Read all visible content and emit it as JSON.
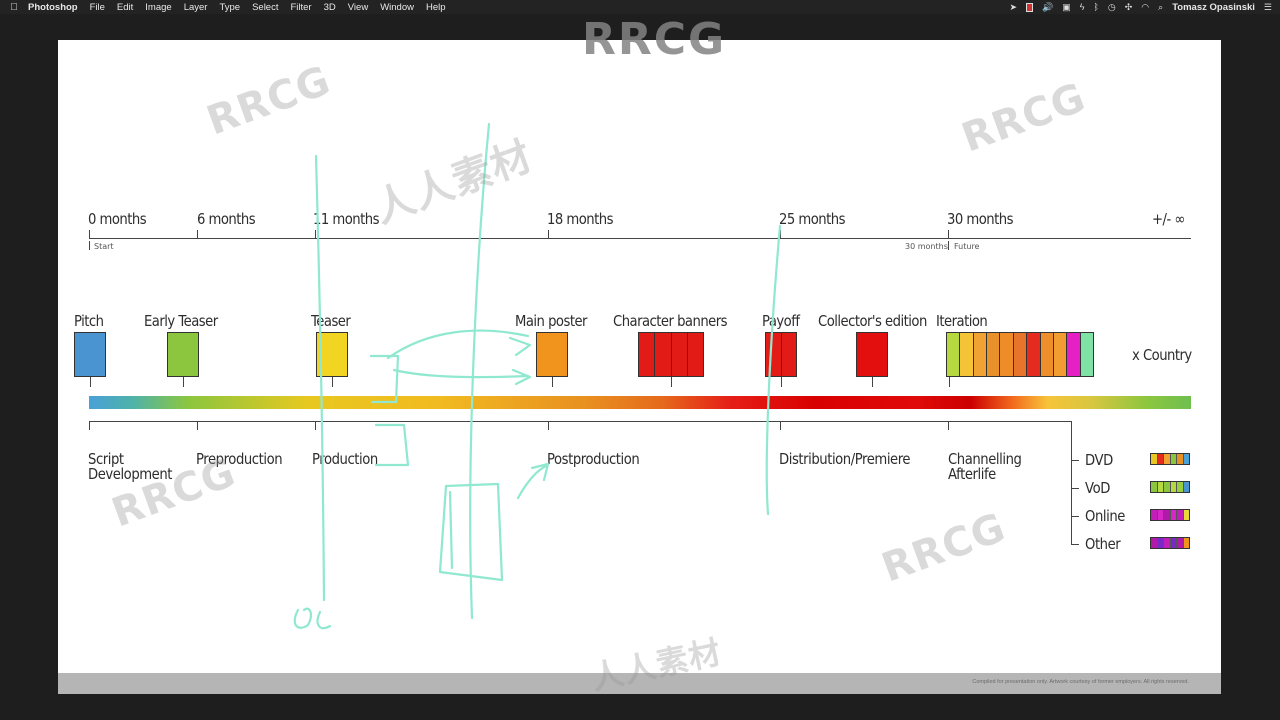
{
  "menubar": {
    "app_name": "Photoshop",
    "menus": [
      "File",
      "Edit",
      "Image",
      "Layer",
      "Type",
      "Select",
      "Filter",
      "3D",
      "View",
      "Window",
      "Help"
    ],
    "user": "Tomasz Opasinski",
    "status_icons": [
      "location-icon",
      "battery-icon",
      "volume-icon",
      "display-icon",
      "power-icon",
      "bluetooth-icon",
      "time-machine-icon",
      "wifi-icon",
      "search-icon",
      "menu-list-icon"
    ]
  },
  "timeline": {
    "months": [
      "0 months",
      "6 months",
      "11 months",
      "18 months",
      "25 months",
      "30 months"
    ],
    "end_label": "+/- ∞",
    "start_note": "Start",
    "end_note_left": "30 months",
    "end_note_right": "Future"
  },
  "items": [
    {
      "label": "Pitch",
      "color": "#4a94d2"
    },
    {
      "label": "Early Teaser",
      "color": "#8cc63f"
    },
    {
      "label": "Teaser",
      "color": "#f2d422"
    },
    {
      "label": "Main poster",
      "color": "#f0941e"
    },
    {
      "label": "Character banners",
      "colors": [
        "#e21b17",
        "#e21b17",
        "#e21b17",
        "#e21b17"
      ]
    },
    {
      "label": "Payoff",
      "colors": [
        "#e21b17",
        "#e21b17"
      ]
    },
    {
      "label": "Collector's edition",
      "color": "#e30f0f"
    },
    {
      "label": "Iteration",
      "colors": [
        "#b6d940",
        "#f5c336",
        "#f0a332",
        "#e8912a",
        "#ee8c2a",
        "#e8732a",
        "#e52b1f",
        "#ef8f2b",
        "#f29d31",
        "#e521c6",
        "#7fe3a5"
      ]
    }
  ],
  "x_country": "x Country",
  "phases": [
    {
      "line1": "Script",
      "line2": "Development"
    },
    {
      "line1": "Preproduction",
      "line2": ""
    },
    {
      "line1": "Production",
      "line2": ""
    },
    {
      "line1": "Postproduction",
      "line2": ""
    },
    {
      "line1": "Distribution/Premiere",
      "line2": ""
    },
    {
      "line1": "Channelling",
      "line2": "Afterlife"
    }
  ],
  "channels": [
    {
      "label": "DVD",
      "colors": [
        "#e8c820",
        "#e52b1f",
        "#f0a332",
        "#8cc63f",
        "#e89020",
        "#4aa0d8"
      ]
    },
    {
      "label": "VoD",
      "colors": [
        "#8cc63f",
        "#b6d940",
        "#8cc63f",
        "#b6d940",
        "#9ad040",
        "#4a94d2"
      ]
    },
    {
      "label": "Online",
      "colors": [
        "#c21fb8",
        "#d826c8",
        "#b01aa8",
        "#d826c8",
        "#c21fb8",
        "#e8d83a"
      ]
    },
    {
      "label": "Other",
      "colors": [
        "#b01aa8",
        "#7a28c8",
        "#c21fb8",
        "#7a28c8",
        "#b01aa8",
        "#f0941e"
      ]
    }
  ],
  "footer": {
    "credits": "Compiled for presentation only. Artwork courtesy of former employers. All rights reserved."
  },
  "watermarks": {
    "logo": "RRCG",
    "brand": "人人素材"
  }
}
